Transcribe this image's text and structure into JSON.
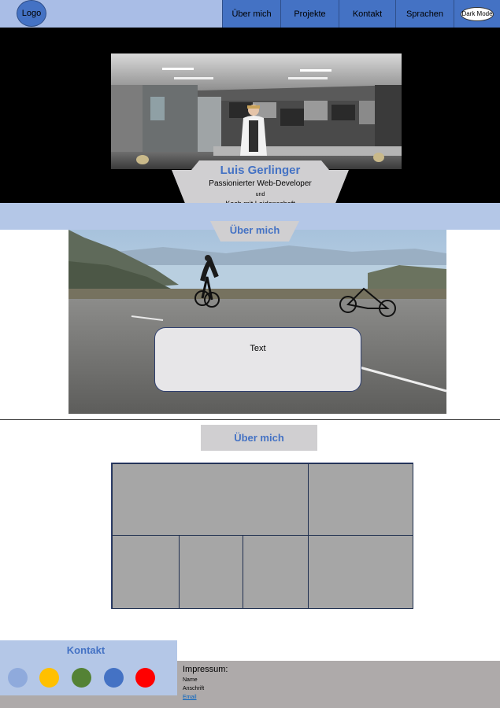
{
  "nav": {
    "logo": "Logo",
    "items": [
      "Über mich",
      "Projekte",
      "Kontakt",
      "Sprachen"
    ],
    "dark_mode": "Dark Mode"
  },
  "hero": {
    "name": "Luis Gerlinger",
    "line1": "Passionierter Web-Developer",
    "und": "und",
    "line2": "Koch mit Leidenschaft",
    "tab": "Über mich"
  },
  "about": {
    "text": "Text",
    "section_title": "Über mich"
  },
  "contact": {
    "title": "Kontakt",
    "dot_colors": [
      "#8faadc",
      "#ffc000",
      "#548235",
      "#4472c4",
      "#ff0000"
    ]
  },
  "footer": {
    "impressum": "Impressum:",
    "name": "Name",
    "anschrift": "Anschrift",
    "email": "Email"
  },
  "colors": {
    "accent": "#4472c4",
    "nav_bg": "#a9bde6",
    "band": "#b4c7e7"
  }
}
